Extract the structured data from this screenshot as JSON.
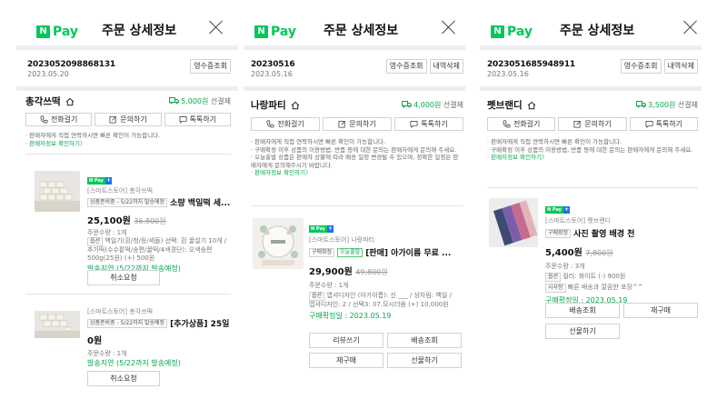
{
  "npay_logo": {
    "n": "N",
    "pay": "Pay"
  },
  "header_title": "주문 상세정보",
  "panels": [
    {
      "order_no": "2023052098868131",
      "order_date": "2023.05.20",
      "order_buttons": [
        "영수증조회"
      ],
      "store_name": "총각쓰떡",
      "shipping_fee": "5,000원",
      "shipping_label": "선결제",
      "actions": [
        "전화걸기",
        "문의하기",
        "톡톡하기"
      ],
      "notes": [
        "· 판매자에게 직접 연락하시면 빠른 확인이 가능합니다."
      ],
      "seller_link": "· 판매자정보 확인하기〉",
      "items": [
        {
          "seller": "[스마트스토어] 총각쓰떡",
          "tag": "상품준비중 - 5/22까지 발송예정",
          "name": "소량 백일떡 세...",
          "price": "25,100원",
          "old_price": "36,800원",
          "qty": "주문수량 : 1개",
          "opt_tag": "옵션",
          "option": "백일기(흰/청/등/세돌) 선택: 흰 꿀설기 10개 / 추가떡(수수팥떡/송편/꿀떡/4색경단): 오색송편 500g(25원) (+) 500원",
          "status": "발송지연 (5/22까지 발송예정)",
          "button": "취소요청"
        },
        {
          "seller": "[스마트스토어] 총각쓰떡",
          "tag": "상품준비중 - 5/22까지 발송예정",
          "name": "[추가상품] 25일",
          "name_cont": "0원",
          "qty": "주문수량 : 1개",
          "status": "발송지연 (5/22까지 발송예정)",
          "button": "취소요청"
        }
      ]
    },
    {
      "order_no": "20230516",
      "order_date": "2023.05.16",
      "order_buttons": [
        "영수증조회",
        "내역삭제"
      ],
      "store_name": "나랑파티",
      "shipping_fee": "4,000원",
      "shipping_label": "선결제",
      "actions": [
        "전화걸기",
        "문의하기",
        "톡톡하기"
      ],
      "notes": [
        "· 판매자에게 직접 연락하시면 빠른 확인이 가능합니다.",
        "· 구매확정 이후 상품의 이용방법, 반품 등에 대한 문의는 판매자에게 문의해 주세요.",
        "· 오늘출발 상품은 판매자 상황에 따라 배송 일정 변경될 수 있으며, 정확한 일정은 판매자에게 문의해주시기 바랍니다."
      ],
      "seller_link": "· 판매자정보 확인하기〉",
      "items": [
        {
          "seller": "[스마트스토어] 나랑파티",
          "tag": "구매확정",
          "tag2": "오늘출발",
          "name": "[판매] 아가이름 무료 ...",
          "price": "29,900원",
          "old_price": "49,800원",
          "qty": "주문수량 : 1개",
          "opt_tag": "옵션",
          "option": "앱셔디자인 (아가이름): 신 ___ / 상차림: 백일 / 앱셔디자인: 2 / 선택3: 07.모시더옴 (+) 10,000원",
          "status": "구매확정일 : 2023.05.19",
          "buttons": [
            "리뷰쓰기",
            "배송조회",
            "재구매",
            "선물하기"
          ]
        }
      ]
    },
    {
      "order_no": "2023051685948911",
      "order_date": "2023.05.16",
      "order_buttons": [
        "영수증조회",
        "내역삭제"
      ],
      "store_name": "펫브랜디",
      "shipping_fee": "3,500원",
      "shipping_label": "선결제",
      "actions": [
        "전화걸기",
        "문의하기",
        "톡톡하기"
      ],
      "notes": [
        "· 판매자에게 직접 연락하시면 빠른 확인이 가능합니다.",
        "· 구매확정 이후 상품의 이용방법, 반품 등에 대한 문의는 판매자에게 문의해 주세요."
      ],
      "seller_link": "· 판매자정보 확인하기〉",
      "items": [
        {
          "seller": "[스마트스토어] 펫브랜디",
          "tag": "구매확정",
          "name": "사진 촬영 배경 천",
          "price": "5,400원",
          "old_price": "7,800원",
          "qty": "주문수량 : 3개",
          "opt_tag": "옵션",
          "option": "컬러: 화이트 (-) 900원",
          "req_tag": "시사항",
          "request": "빠른 배송과 깔끔한 포장^^",
          "status": "구매확정일 : 2023.05.19",
          "buttons": [
            "배송조회",
            "재구매",
            "선물하기"
          ]
        }
      ]
    }
  ],
  "colors": {
    "brand_green": "#03c75a",
    "link_green": "#03a94d",
    "separator": "#eceef1"
  }
}
